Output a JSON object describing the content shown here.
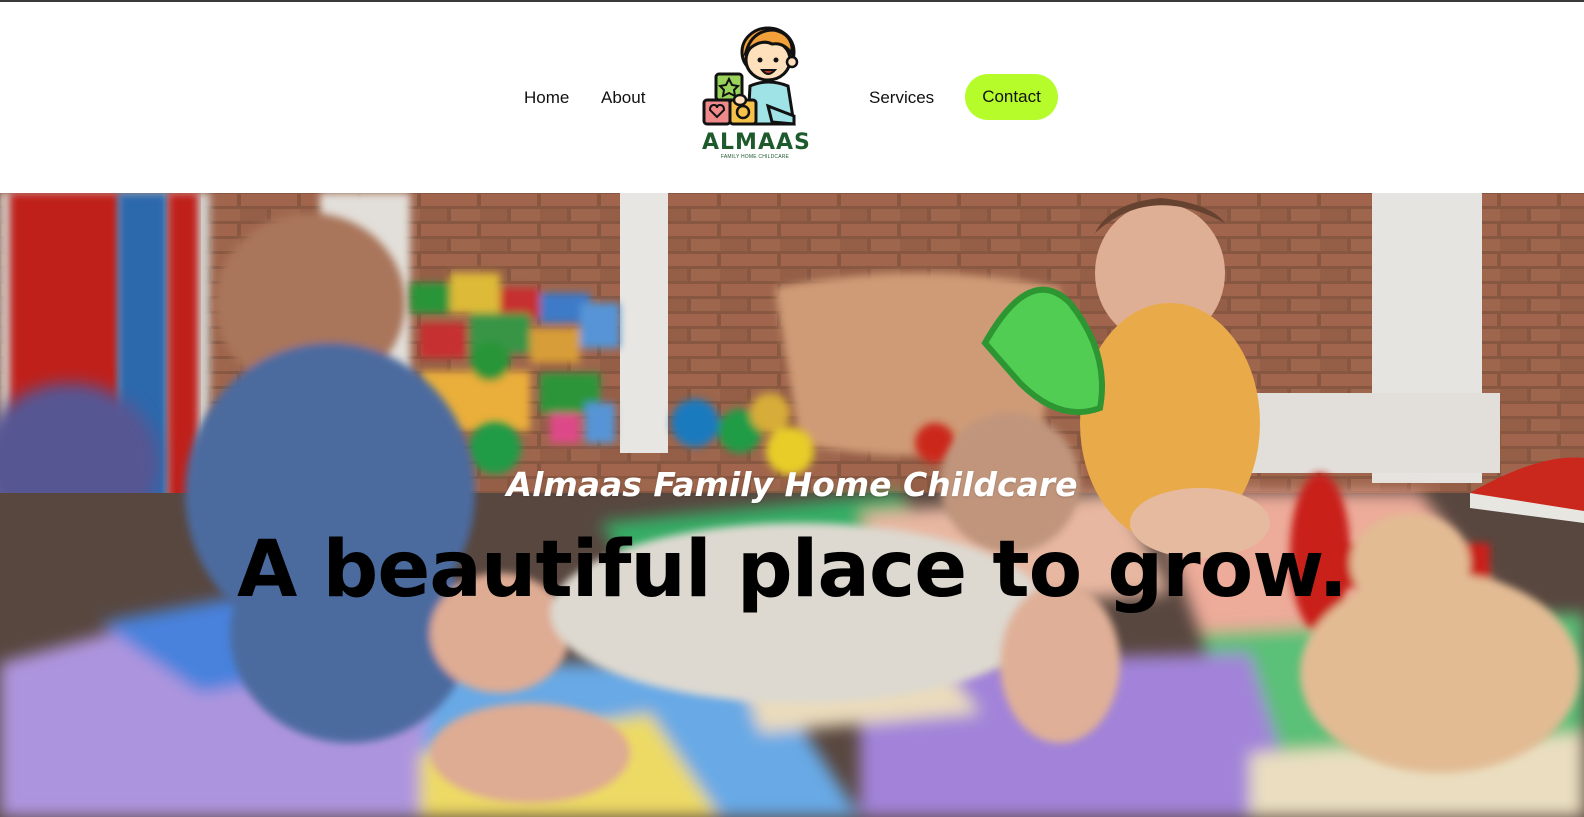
{
  "nav": {
    "home_label": "Home",
    "about_label": "About",
    "services_label": "Services",
    "contact_label": "Contact"
  },
  "logo": {
    "name": "ALMAAS",
    "tagline": "FAMILY HOME CHILDCARE",
    "icon": "toddler-with-blocks-icon"
  },
  "hero": {
    "eyebrow": "Almaas Family Home Childcare",
    "title": "A beautiful place to grow.",
    "image": "babies-playing-on-foam-mat-photo"
  },
  "colors": {
    "accent": "#b5fc2a",
    "logo_green": "#1d5a2c",
    "text": "#111111",
    "background": "#ffffff"
  }
}
